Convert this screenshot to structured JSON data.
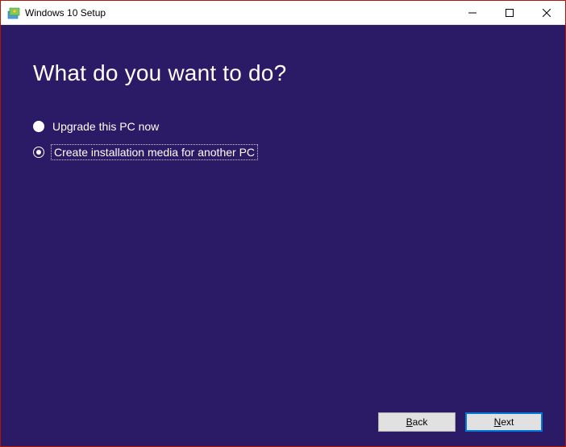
{
  "window": {
    "title": "Windows 10 Setup"
  },
  "main": {
    "heading": "What do you want to do?",
    "options": [
      {
        "label": "Upgrade this PC now",
        "selected": false
      },
      {
        "label": "Create installation media for another PC",
        "selected": true
      }
    ]
  },
  "footer": {
    "back_prefix": "B",
    "back_rest": "ack",
    "next_prefix": "N",
    "next_rest": "ext"
  }
}
